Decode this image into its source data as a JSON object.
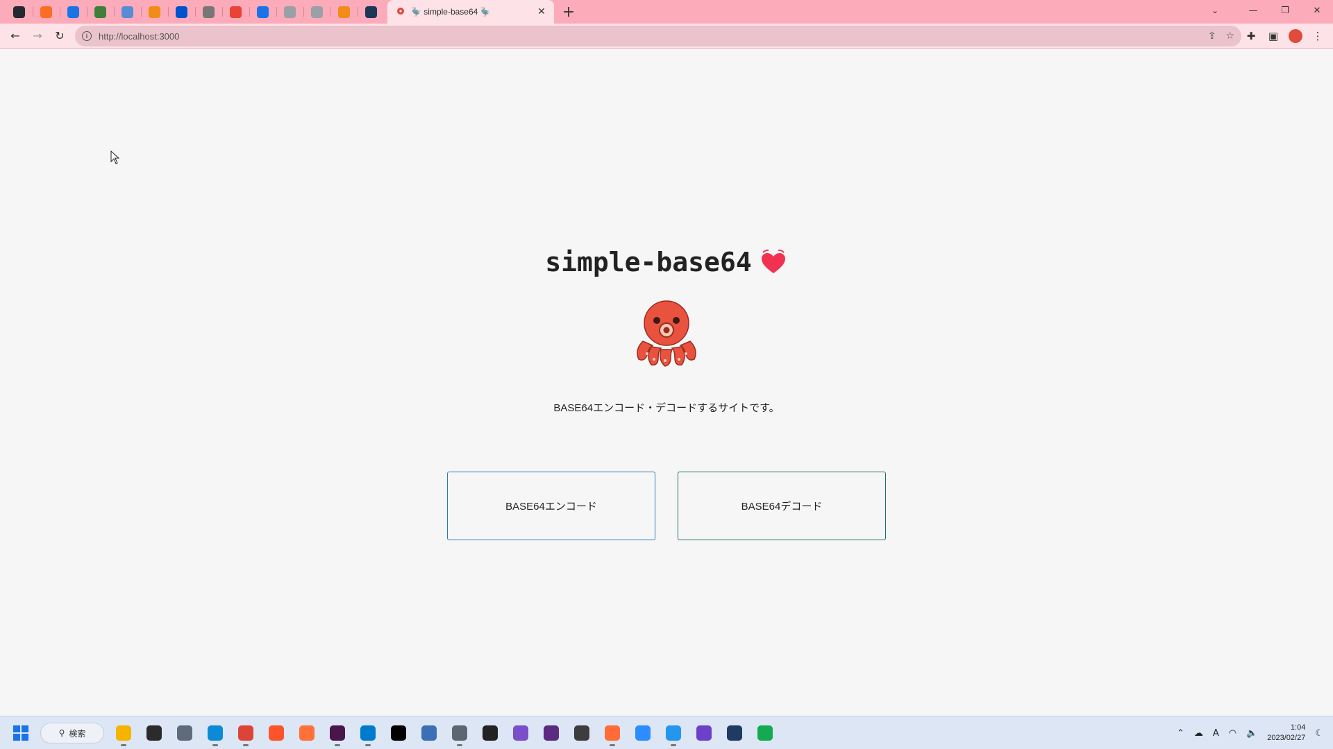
{
  "browser": {
    "pinned_tabs": [
      {
        "icon": "github-icon",
        "color": "#24292f"
      },
      {
        "icon": "gitlab-icon",
        "color": "#fc6d26"
      },
      {
        "icon": "app-icon",
        "color": "#1b74e4"
      },
      {
        "icon": "app-icon",
        "color": "#3f7f3a"
      },
      {
        "icon": "app-icon",
        "color": "#5a8bd6"
      },
      {
        "icon": "app-icon",
        "color": "#f28c18"
      },
      {
        "icon": "atlassian-icon",
        "color": "#0052cc"
      },
      {
        "icon": "app-icon",
        "color": "#777777"
      },
      {
        "icon": "gmail-icon",
        "color": "#ea4335"
      },
      {
        "icon": "calendar-icon",
        "color": "#1a73e8"
      },
      {
        "icon": "app-icon",
        "color": "#9aa0a6"
      },
      {
        "icon": "app-icon",
        "color": "#9aa0a6"
      },
      {
        "icon": "app-icon",
        "color": "#f28c18"
      },
      {
        "icon": "app-icon",
        "color": "#1d3557"
      }
    ],
    "active_tab": {
      "title": "🦤 simple-base64 🦤"
    },
    "url": "http://localhost:3000"
  },
  "page": {
    "title": "simple-base64",
    "tagline": "BASE64エンコード・デコードするサイトです。",
    "buttons": {
      "encode": "BASE64エンコード",
      "decode": "BASE64デコード"
    }
  },
  "taskbar": {
    "search_label": "検索",
    "apps": [
      {
        "name": "file-explorer-icon",
        "color": "#f4b400",
        "running": true
      },
      {
        "name": "terminal-icon",
        "color": "#2b2b2b",
        "running": false
      },
      {
        "name": "settings-icon",
        "color": "#5f6b7a",
        "running": false
      },
      {
        "name": "edge-icon",
        "color": "#0c8ad6",
        "running": true
      },
      {
        "name": "chrome-icon",
        "color": "#db4437",
        "running": true
      },
      {
        "name": "brave-icon",
        "color": "#fb542b",
        "running": false
      },
      {
        "name": "firefox-icon",
        "color": "#ff7139",
        "running": false
      },
      {
        "name": "slack-icon",
        "color": "#4a154b",
        "running": true
      },
      {
        "name": "vscode-icon",
        "color": "#007acc",
        "running": true
      },
      {
        "name": "intellij-icon",
        "color": "#000000",
        "running": false
      },
      {
        "name": "notepad-icon",
        "color": "#3b6fb6",
        "running": false
      },
      {
        "name": "remote-desktop-icon",
        "color": "#5c6670",
        "running": true
      },
      {
        "name": "inkscape-icon",
        "color": "#222222",
        "running": false
      },
      {
        "name": "visual-studio-icon",
        "color": "#7a4fc9",
        "running": false
      },
      {
        "name": "affinity-icon",
        "color": "#5b2b82",
        "running": false
      },
      {
        "name": "sourcetree-icon",
        "color": "#3d3d3d",
        "running": false
      },
      {
        "name": "postman-icon",
        "color": "#ff6c37",
        "running": true
      },
      {
        "name": "zoom-icon",
        "color": "#2d8cff",
        "running": false
      },
      {
        "name": "docker-icon",
        "color": "#2496ed",
        "running": true
      },
      {
        "name": "github-desktop-icon",
        "color": "#6e40c9",
        "running": false
      },
      {
        "name": "db-tool-icon",
        "color": "#1f3a63",
        "running": false
      },
      {
        "name": "mongodb-icon",
        "color": "#13aa52",
        "running": false
      }
    ],
    "time": "1:04",
    "date": "2023/02/27",
    "ime": "A"
  }
}
